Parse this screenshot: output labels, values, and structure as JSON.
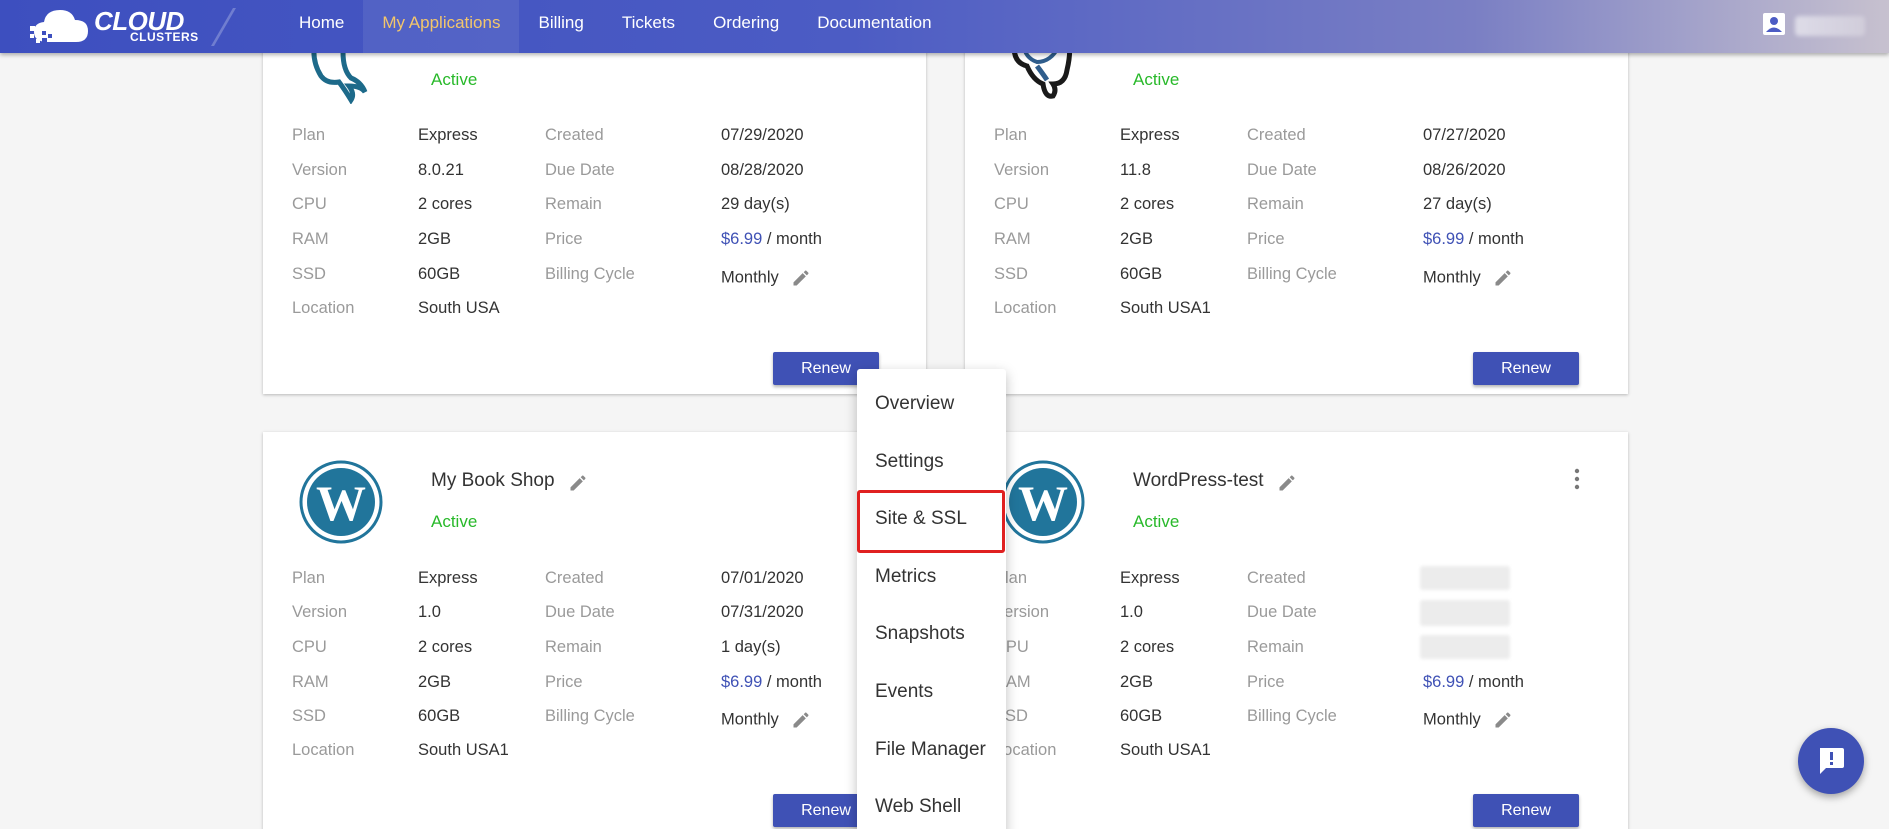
{
  "brand": {
    "line1": "CLOUD",
    "line2": "CLUSTERS"
  },
  "nav": [
    {
      "label": "Home"
    },
    {
      "label": "My Applications"
    },
    {
      "label": "Billing"
    },
    {
      "label": "Tickets"
    },
    {
      "label": "Ordering"
    },
    {
      "label": "Documentation"
    }
  ],
  "labels": {
    "plan": "Plan",
    "version": "Version",
    "cpu": "CPU",
    "ram": "RAM",
    "ssd": "SSD",
    "location": "Location",
    "created": "Created",
    "due": "Due Date",
    "remain": "Remain",
    "price": "Price",
    "cycle": "Billing Cycle",
    "per_month": " / month",
    "renew": "Renew"
  },
  "cards": [
    {
      "title": "",
      "status": "Active",
      "plan": "Express",
      "version": "8.0.21",
      "cpu": "2 cores",
      "ram": "2GB",
      "ssd": "60GB",
      "location": "South USA",
      "created": "07/29/2020",
      "due": "08/28/2020",
      "remain": "29 day(s)",
      "price": "$6.99",
      "cycle": "Monthly"
    },
    {
      "title": "",
      "status": "Active",
      "plan": "Express",
      "version": "11.8",
      "cpu": "2 cores",
      "ram": "2GB",
      "ssd": "60GB",
      "location": "South USA1",
      "created": "07/27/2020",
      "due": "08/26/2020",
      "remain": "27 day(s)",
      "price": "$6.99",
      "cycle": "Monthly"
    },
    {
      "title": "My Book Shop",
      "status": "Active",
      "plan": "Express",
      "version": "1.0",
      "cpu": "2 cores",
      "ram": "2GB",
      "ssd": "60GB",
      "location": "South USA1",
      "created": "07/01/2020",
      "due": "07/31/2020",
      "remain": "1 day(s)",
      "price": "$6.99",
      "cycle": "Monthly"
    },
    {
      "title": "WordPress-test",
      "status": "Active",
      "plan": "Express",
      "version": "1.0",
      "cpu": "2 cores",
      "ram": "2GB",
      "ssd": "60GB",
      "location": "South USA1",
      "created": "",
      "due": "",
      "remain": "",
      "price": "$6.99",
      "cycle": "Monthly"
    }
  ],
  "menu": [
    {
      "label": "Overview"
    },
    {
      "label": "Settings"
    },
    {
      "label": "Site & SSL"
    },
    {
      "label": "Metrics"
    },
    {
      "label": "Snapshots"
    },
    {
      "label": "Events"
    },
    {
      "label": "File Manager"
    },
    {
      "label": "Web Shell"
    }
  ],
  "colors": {
    "nav_start": "#3d4fbf",
    "accent": "#3f51b5",
    "active_nav": "#f3c66b",
    "status": "#28b92a",
    "highlight": "#e02020"
  },
  "icons": {
    "user": "account-box-icon",
    "chat": "chat-alert-icon",
    "edit": "pencil-icon",
    "more": "more-vertical-icon"
  }
}
